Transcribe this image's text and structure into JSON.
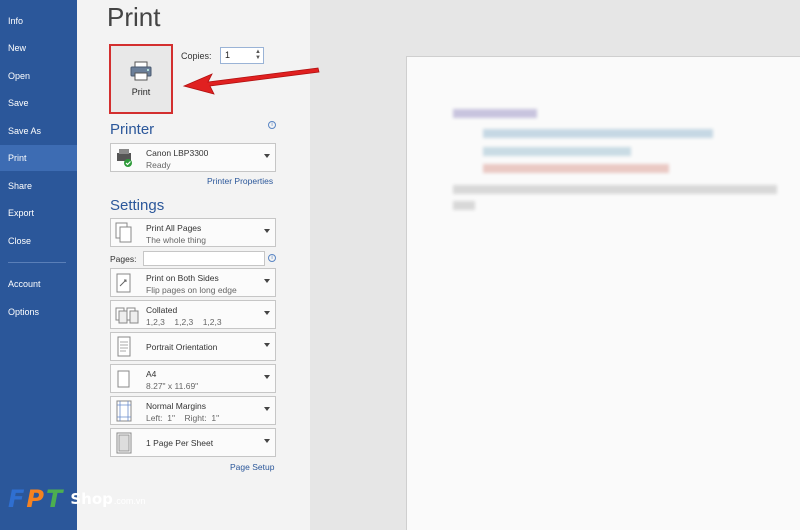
{
  "nav": {
    "items": [
      {
        "label": "Info"
      },
      {
        "label": "New"
      },
      {
        "label": "Open"
      },
      {
        "label": "Save"
      },
      {
        "label": "Save As"
      },
      {
        "label": "Print",
        "active": true
      },
      {
        "label": "Share"
      },
      {
        "label": "Export"
      },
      {
        "label": "Close"
      },
      {
        "label": "Account"
      },
      {
        "label": "Options"
      }
    ]
  },
  "logo": {
    "f": "F",
    "p": "P",
    "t": "T",
    "shop": "Shop",
    "domain": ".com.vn"
  },
  "page_title": "Print",
  "print_button": {
    "label": "Print",
    "icon": "printer-icon"
  },
  "copies": {
    "label": "Copies:",
    "value": "1"
  },
  "printer": {
    "heading": "Printer",
    "name": "Canon LBP3300",
    "status": "Ready",
    "properties_link": "Printer Properties"
  },
  "settings": {
    "heading": "Settings",
    "range": {
      "l1": "Print All Pages",
      "l2": "The whole thing"
    },
    "pages_label": "Pages:",
    "sides": {
      "l1": "Print on Both Sides",
      "l2": "Flip pages on long edge"
    },
    "collation": {
      "l1": "Collated",
      "l2": "1,2,3    1,2,3    1,2,3"
    },
    "orientation": {
      "l1": "Portrait Orientation"
    },
    "paper": {
      "l1": "A4",
      "l2": "8.27\" x 11.69\""
    },
    "margins": {
      "l1": "Normal Margins",
      "l2": "Left:  1\"    Right:  1\""
    },
    "per_sheet": {
      "l1": "1 Page Per Sheet"
    },
    "page_setup_link": "Page Setup"
  },
  "colors": {
    "nav_bg": "#2b579a",
    "accent": "#2b579a",
    "highlight_box": "#d32f2f",
    "arrow": "#e02020"
  }
}
